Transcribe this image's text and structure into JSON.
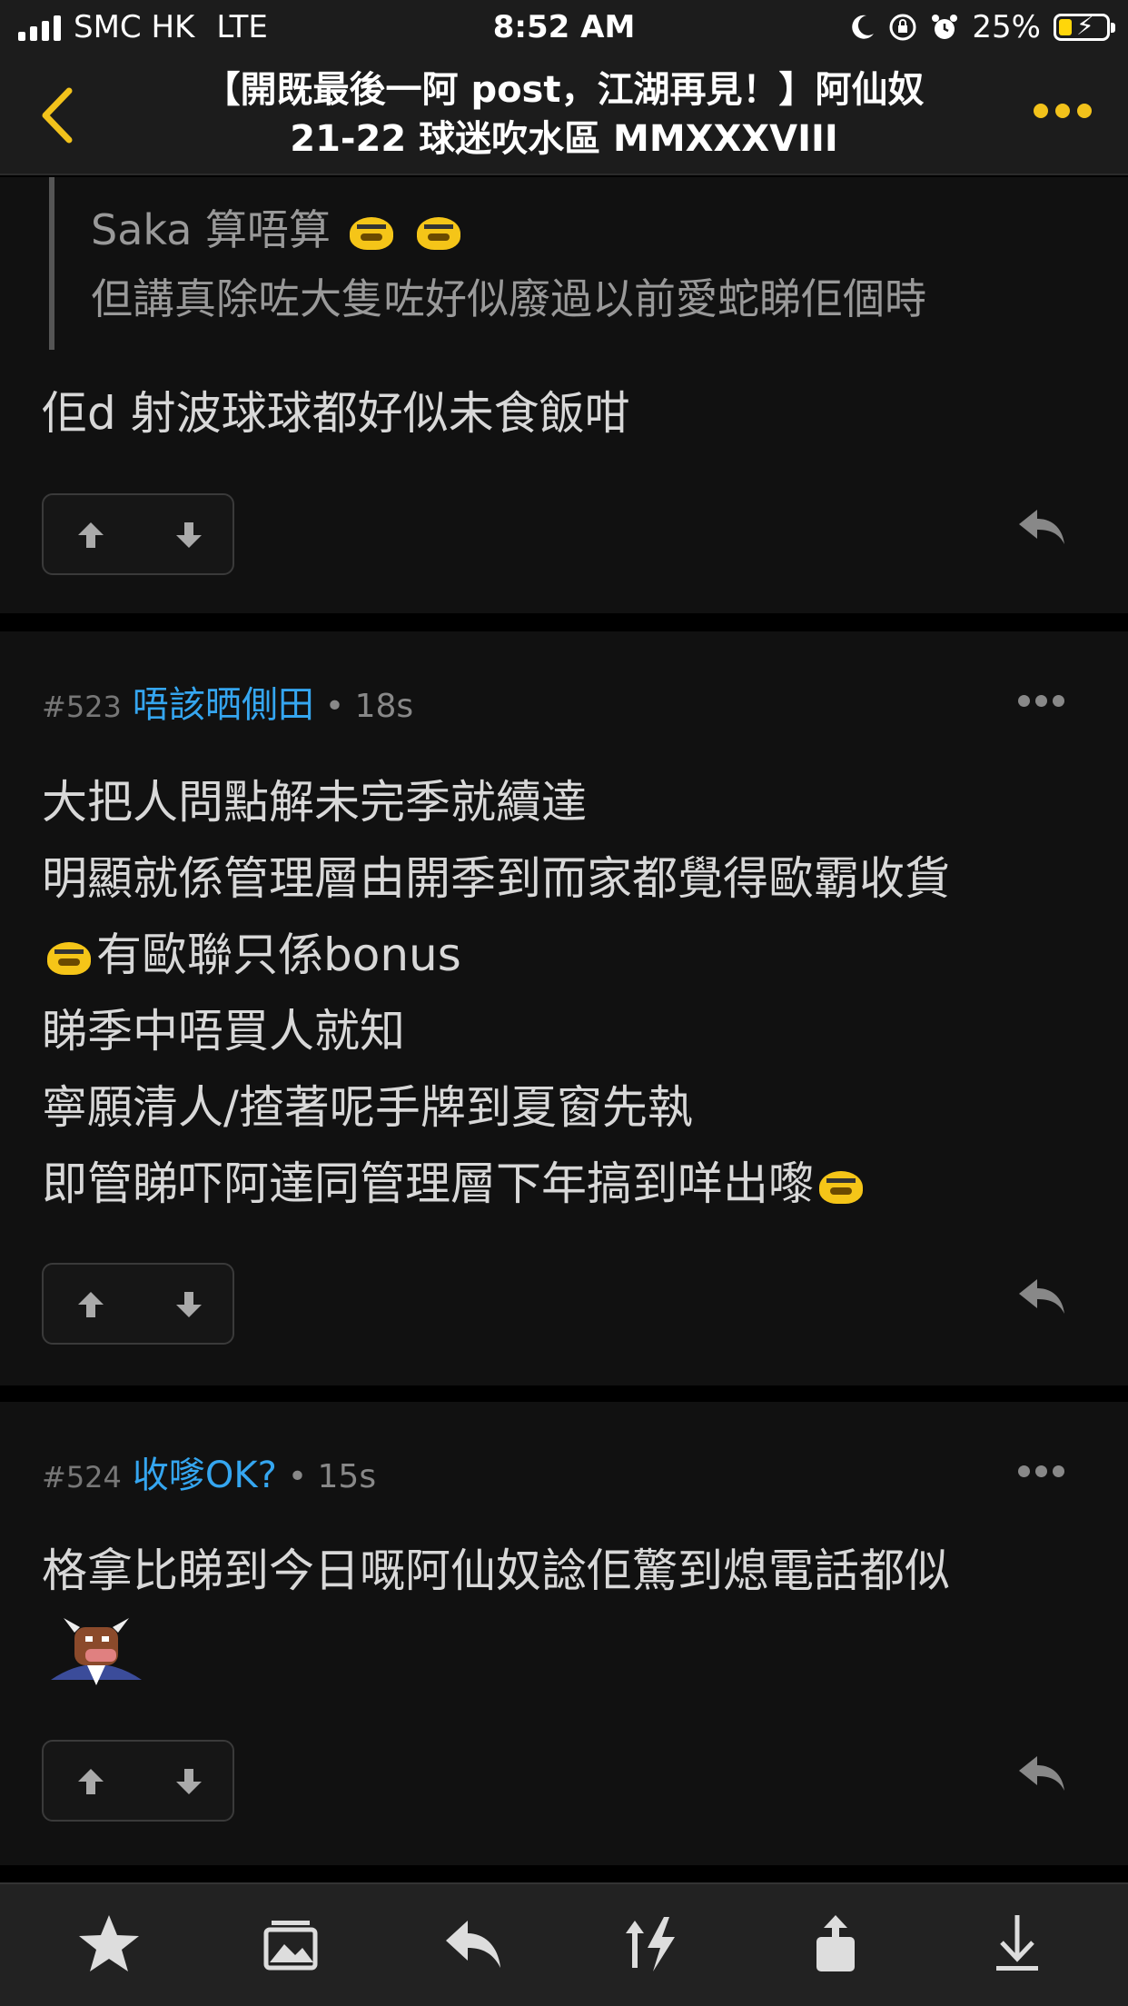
{
  "status_bar": {
    "carrier": "SMC HK",
    "network": "LTE",
    "time": "8:52 AM",
    "battery": "25%"
  },
  "nav": {
    "title_line1": "【開既最後一阿 post，江湖再見！】阿仙奴",
    "title_line2": "21-22 球迷吹水區 MMXXXVIII",
    "accent_color": "#f2c21b"
  },
  "post_prev": {
    "quote_line1": "Saka 算唔算",
    "quote_line2": "但講真除咗大隻咗好似廢過以前愛蛇睇佢個時",
    "body": "佢d 射波球球都好似未食飯咁"
  },
  "post_523": {
    "number": "#523",
    "username": "唔該晒側田",
    "time": "• 18s",
    "lines": [
      "大把人問點解未完季就續達",
      "明顯就係管理層由開季到而家都覺得歐霸收貨",
      "有歐聯只係bonus",
      "睇季中唔買人就知",
      "寧願清人/揸著呢手牌到夏窗先執",
      "即管睇吓阿達同管理層下年搞到咩出嚟"
    ]
  },
  "post_524": {
    "number": "#524",
    "username": "收嗲OK?",
    "time": "• 15s",
    "body": "格拿比睇到今日嘅阿仙奴諗佢驚到熄電話都似"
  },
  "toolbar": {
    "icons": [
      "star-icon",
      "gallery-icon",
      "reply-icon",
      "sort-icon",
      "share-icon",
      "download-icon"
    ]
  },
  "colors": {
    "username": "#35a6f0",
    "background": "#111111"
  }
}
